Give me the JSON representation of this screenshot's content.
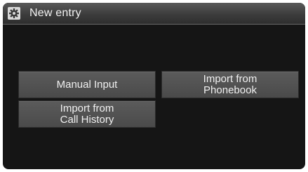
{
  "header": {
    "title": "New entry",
    "icon": "settings-gear-icon"
  },
  "menu": {
    "manual_input": "Manual Input",
    "import_phonebook": "Import from\nPhonebook",
    "import_call_history": "Import from\nCall History"
  },
  "colors": {
    "background": "#151515",
    "button": "#505050",
    "text": "#f0f0f0"
  }
}
